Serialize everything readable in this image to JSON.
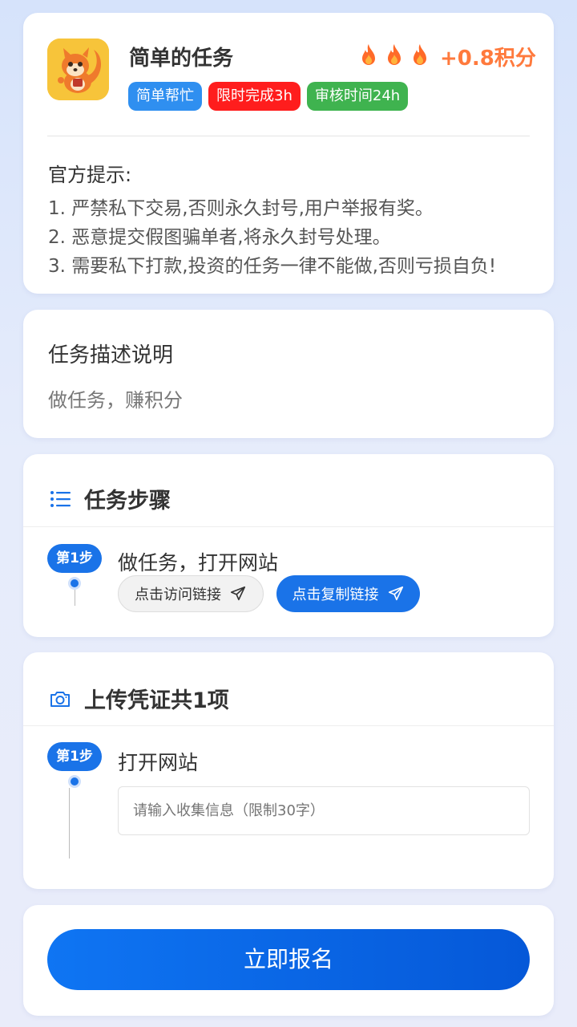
{
  "task": {
    "title": "简单的任务",
    "points": "+0.8积分",
    "tags": [
      {
        "label": "简单帮忙",
        "color": "#2f8ff0"
      },
      {
        "label": "限时完成3h",
        "color": "#ff1d1d"
      },
      {
        "label": "审核时间24h",
        "color": "#3fb34f"
      }
    ],
    "fire_count": 3
  },
  "tips": {
    "title": "官方提示:",
    "lines": [
      "1. 严禁私下交易,否则永久封号,用户举报有奖。",
      "2. 恶意提交假图骗单者,将永久封号处理。",
      "3. 需要私下打款,投资的任务一律不能做,否则亏损自负!"
    ]
  },
  "description": {
    "title": "任务描述说明",
    "text": "做任务，赚积分"
  },
  "steps": {
    "title": "任务步骤",
    "items": [
      {
        "badge": "第1步",
        "title": "做任务，打开网站",
        "visit_label": "点击访问链接",
        "copy_label": "点击复制链接"
      }
    ]
  },
  "upload": {
    "title": "上传凭证共1项",
    "items": [
      {
        "badge": "第1步",
        "title": "打开网站",
        "placeholder": "请输入收集信息（限制30字）"
      }
    ]
  },
  "submit": {
    "label": "立即报名"
  },
  "colors": {
    "accent": "#1a73e8",
    "points": "#ff7a3d"
  }
}
